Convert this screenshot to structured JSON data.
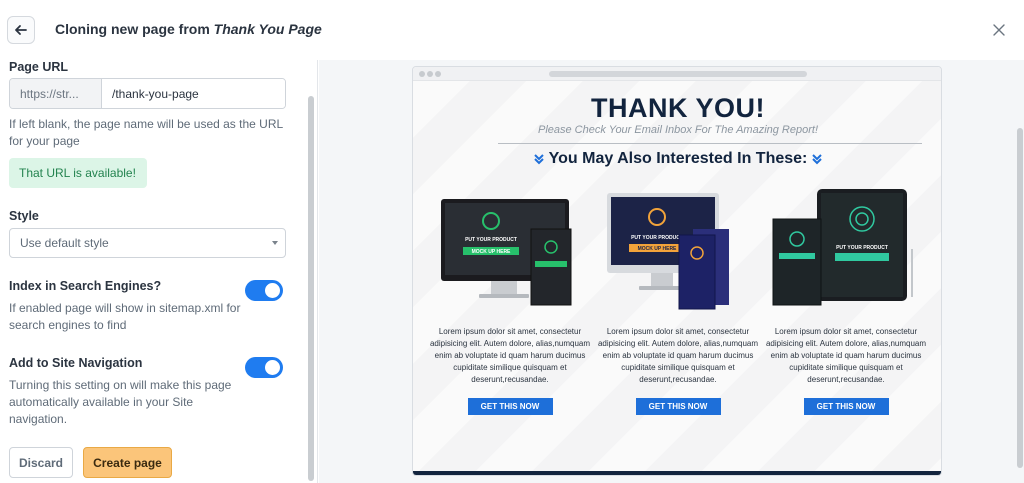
{
  "header": {
    "title_prefix": "Cloning new page from ",
    "title_page": "Thank You Page",
    "back_icon": "arrow-left-icon",
    "close_icon": "close-icon"
  },
  "form": {
    "page_url_label": "Page URL",
    "url_prefix": "https://str...",
    "url_value": "/thank-you-page",
    "url_help": "If left blank, the page name will be used as the URL for your page",
    "url_status": "That URL is available!",
    "style_label": "Style",
    "style_value": "Use default style",
    "index_label": "Index in Search Engines?",
    "index_help": "If enabled page will show in sitemap.xml for search engines to find",
    "index_enabled": true,
    "nav_label": "Add to Site Navigation",
    "nav_help": "Turning this setting on will make this page automatically available in your Site navigation.",
    "nav_enabled": true,
    "discard_label": "Discard",
    "create_label": "Create page"
  },
  "preview": {
    "title": "THANK YOU!",
    "subtitle": "Please Check Your Email Inbox For The Amazing Report!",
    "heading": "You May Also Interested In These:",
    "mock_line1": "PUT YOUR PRODUCT",
    "mock_line2": "MOCK UP HERE",
    "cards": [
      {
        "text": "Lorem ipsum dolor sit amet, consectetur adipisicing elit. Autem dolore, alias,numquam enim ab voluptate id quam harum ducimus cupiditate similique quisquam et deserunt,recusandae.",
        "cta": "GET THIS NOW"
      },
      {
        "text": "Lorem ipsum dolor sit amet, consectetur adipisicing elit. Autem dolore, alias,numquam enim ab voluptate id quam harum ducimus cupiditate similique quisquam et deserunt,recusandae.",
        "cta": "GET THIS NOW"
      },
      {
        "text": "Lorem ipsum dolor sit amet, consectetur adipisicing elit. Autem dolore, alias,numquam enim ab voluptate id quam harum ducimus cupiditate similique quisquam et deserunt,recusandae.",
        "cta": "GET THIS NOW"
      }
    ]
  },
  "colors": {
    "accent": "#1f7cf0",
    "create_button": "#fbc57a",
    "success_bg": "#dcf5e7",
    "success_text": "#23834f",
    "preview_navy": "#12243e",
    "cta_blue": "#1e6fd9"
  }
}
